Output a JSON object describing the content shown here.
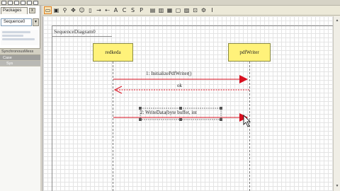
{
  "colors": {
    "lifeline_fill": "#fff27a",
    "message_color": "#d81020",
    "selection_handle": "#555555"
  },
  "left_panel": {
    "tab_label": "Packages",
    "close_glyph": "x",
    "dropdown_value": "Sequence0",
    "sub_header": "SynchronousMess",
    "items": [
      {
        "label": "Case"
      },
      {
        "label": "Sys"
      }
    ]
  },
  "toolbar": {
    "icons": [
      "select-icon",
      "note-icon",
      "zoom-icon",
      "pan-icon",
      "actor-icon",
      "lifeline-icon",
      "message-icon",
      "return-icon",
      "text-icon",
      "letter-c-icon",
      "letter-s-icon",
      "letter-p-icon",
      "frame-icon",
      "fragment-icon",
      "combined-icon",
      "box-icon",
      "image-icon",
      "link-icon",
      "gear-icon",
      "text-cursor-icon"
    ]
  },
  "diagram": {
    "title": "SequenceDiagram0",
    "lifelines": [
      {
        "name": "redkeda"
      },
      {
        "name": "pdfWriter"
      }
    ],
    "messages": [
      {
        "label": "1: InitializePdfWriter()",
        "kind": "call"
      },
      {
        "label": "ok",
        "kind": "return"
      },
      {
        "label": "2: WriteData(byte buffer, int",
        "kind": "call",
        "selected": true
      }
    ]
  }
}
